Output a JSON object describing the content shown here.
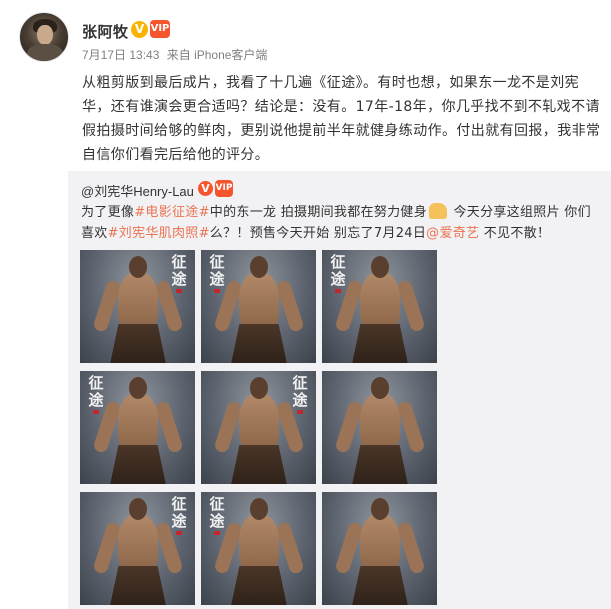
{
  "post": {
    "author": "张阿牧",
    "badge_v": "V",
    "badge_member": "VIP",
    "date": "7月17日 13:43",
    "source": "来自 iPhone客户端",
    "content": "从粗剪版到最后成片，我看了十几遍《征途》。有时也想，如果东一龙不是刘宪华，还有谁演会更合适吗？结论是：没有。17年-18年，你几乎找不到不轧戏不请假拍摄时间给够的鲜肉，更别说他提前半年就健身练动作。付出就有回报，我非常自信你们看完后给他的评分。"
  },
  "repost": {
    "author": "@刘宪华Henry-Lau",
    "badge_v": "V",
    "badge_member": "VIP",
    "text_part1": "为了更像",
    "hashtag1": "#电影征途#",
    "text_part2": "中的东一龙 拍摄期间我都在努力健身",
    "text_part3": " 今天分享这组照片 你们喜欢",
    "hashtag2": "#刘宪华肌肉照#",
    "text_part4": "么？！预售今天开始 别忘了7月24日",
    "mention": "@爱奇艺",
    "text_part5": " 不见不散！",
    "photo_title": "征途",
    "photos": [
      {
        "name": "photo-1"
      },
      {
        "name": "photo-2"
      },
      {
        "name": "photo-3"
      },
      {
        "name": "photo-4"
      },
      {
        "name": "photo-5"
      },
      {
        "name": "photo-6"
      },
      {
        "name": "photo-7"
      },
      {
        "name": "photo-8"
      },
      {
        "name": "photo-9"
      }
    ]
  },
  "icons": {
    "avatar": "avatar-image",
    "verified": "verified-v-icon",
    "member": "member-crown-icon",
    "flex": "flexed-biceps-emoji"
  },
  "colors": {
    "link": "#eb7350",
    "repost_bg": "#f2f2f5",
    "verified_gold": "#f7b500",
    "member_red": "#f6542d"
  }
}
